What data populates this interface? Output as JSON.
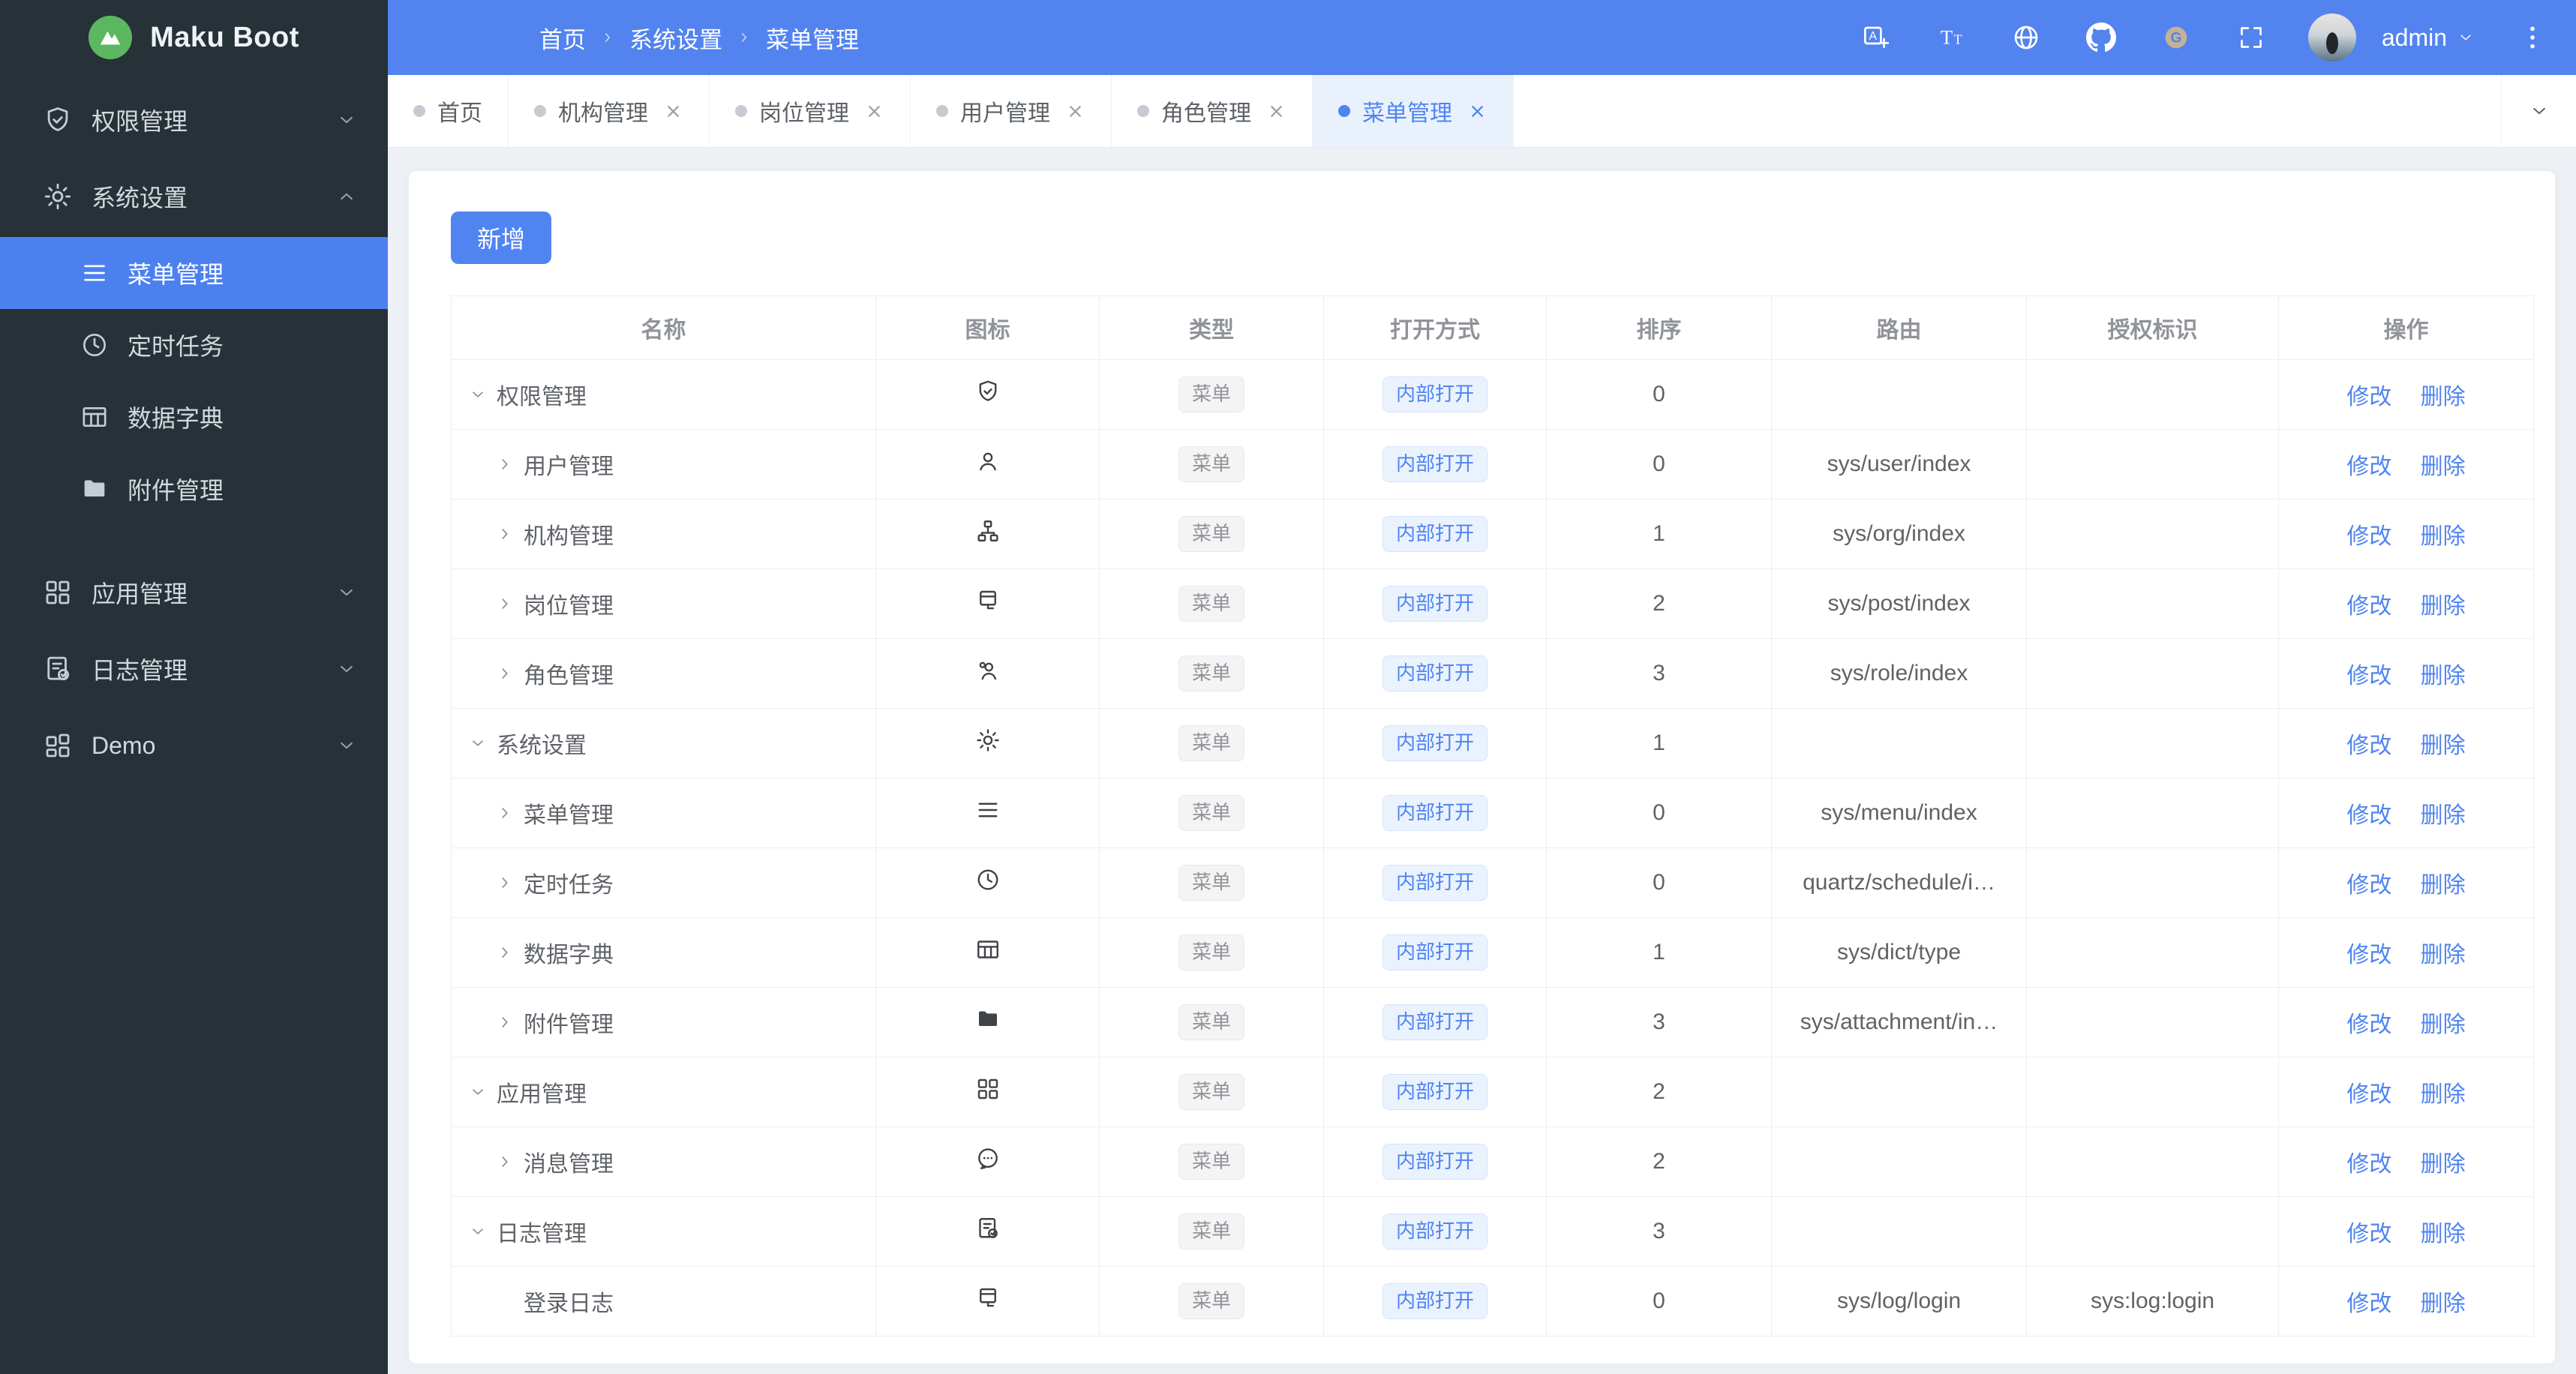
{
  "colors": {
    "accent": "#4f84f1",
    "header_bg": "#5383ef",
    "sidebar_bg": "#263238",
    "sidebar_active_bg": "#4c80ef",
    "content_bg": "#edf0f5",
    "active_tab_bg": "#e9f1fd",
    "logo_green": "#5cb860",
    "badge_gray_bg": "#f4f4f5",
    "badge_gray_text": "#909399",
    "badge_blue_bg": "#eaf2fe",
    "gitee_gold": "#c3b393"
  },
  "sidebar": {
    "logo_title": "Maku Boot",
    "items": [
      {
        "id": "permission",
        "label": "权限管理",
        "icon": "shield-check",
        "chevron": "down"
      },
      {
        "id": "system",
        "label": "系统设置",
        "icon": "gear",
        "chevron": "up",
        "children": [
          {
            "id": "menu",
            "label": "菜单管理",
            "icon": "menu",
            "active": true
          },
          {
            "id": "schedule",
            "label": "定时任务",
            "icon": "clock",
            "active": false
          },
          {
            "id": "dict",
            "label": "数据字典",
            "icon": "table",
            "active": false
          },
          {
            "id": "attachment",
            "label": "附件管理",
            "icon": "folder",
            "active": false
          }
        ]
      },
      {
        "id": "app",
        "label": "应用管理",
        "icon": "grid",
        "chevron": "down"
      },
      {
        "id": "log",
        "label": "日志管理",
        "icon": "doc-check",
        "chevron": "down"
      },
      {
        "id": "demo",
        "label": "Demo",
        "icon": "grid2",
        "chevron": "down"
      }
    ]
  },
  "header": {
    "breadcrumb": [
      "首页",
      "系统设置",
      "菜单管理"
    ],
    "actions": [
      {
        "id": "translate"
      },
      {
        "id": "font-size"
      },
      {
        "id": "globe"
      },
      {
        "id": "github"
      },
      {
        "id": "gitee"
      },
      {
        "id": "fullscreen"
      }
    ],
    "user": "admin"
  },
  "tabs": {
    "items": [
      {
        "id": "home",
        "label": "首页",
        "closable": false,
        "active": false
      },
      {
        "id": "org",
        "label": "机构管理",
        "closable": true,
        "active": false
      },
      {
        "id": "post",
        "label": "岗位管理",
        "closable": true,
        "active": false
      },
      {
        "id": "user",
        "label": "用户管理",
        "closable": true,
        "active": false
      },
      {
        "id": "role",
        "label": "角色管理",
        "closable": true,
        "active": false
      },
      {
        "id": "menu",
        "label": "菜单管理",
        "closable": true,
        "active": true
      }
    ]
  },
  "toolbar": {
    "add_label": "新增"
  },
  "table": {
    "columns": [
      "名称",
      "图标",
      "类型",
      "打开方式",
      "排序",
      "路由",
      "授权标识",
      "操作"
    ],
    "ops": {
      "edit": "修改",
      "delete": "删除"
    },
    "rows": [
      {
        "level": 0,
        "expand": "down",
        "name": "权限管理",
        "icon": "shield-check",
        "type": "菜单",
        "open": "内部打开",
        "sort": "0",
        "route": "",
        "auth": ""
      },
      {
        "level": 1,
        "expand": "right",
        "name": "用户管理",
        "icon": "user",
        "type": "菜单",
        "open": "内部打开",
        "sort": "0",
        "route": "sys/user/index",
        "auth": ""
      },
      {
        "level": 1,
        "expand": "right",
        "name": "机构管理",
        "icon": "org",
        "type": "菜单",
        "open": "内部打开",
        "sort": "1",
        "route": "sys/org/index",
        "auth": ""
      },
      {
        "level": 1,
        "expand": "right",
        "name": "岗位管理",
        "icon": "badge",
        "type": "菜单",
        "open": "内部打开",
        "sort": "2",
        "route": "sys/post/index",
        "auth": ""
      },
      {
        "level": 1,
        "expand": "right",
        "name": "角色管理",
        "icon": "user-plus",
        "type": "菜单",
        "open": "内部打开",
        "sort": "3",
        "route": "sys/role/index",
        "auth": ""
      },
      {
        "level": 0,
        "expand": "down",
        "name": "系统设置",
        "icon": "gear",
        "type": "菜单",
        "open": "内部打开",
        "sort": "1",
        "route": "",
        "auth": ""
      },
      {
        "level": 1,
        "expand": "right",
        "name": "菜单管理",
        "icon": "menu",
        "type": "菜单",
        "open": "内部打开",
        "sort": "0",
        "route": "sys/menu/index",
        "auth": ""
      },
      {
        "level": 1,
        "expand": "right",
        "name": "定时任务",
        "icon": "clock",
        "type": "菜单",
        "open": "内部打开",
        "sort": "0",
        "route": "quartz/schedule/i…",
        "auth": ""
      },
      {
        "level": 1,
        "expand": "right",
        "name": "数据字典",
        "icon": "table",
        "type": "菜单",
        "open": "内部打开",
        "sort": "1",
        "route": "sys/dict/type",
        "auth": ""
      },
      {
        "level": 1,
        "expand": "right",
        "name": "附件管理",
        "icon": "folder",
        "type": "菜单",
        "open": "内部打开",
        "sort": "3",
        "route": "sys/attachment/in…",
        "auth": ""
      },
      {
        "level": 0,
        "expand": "down",
        "name": "应用管理",
        "icon": "grid",
        "type": "菜单",
        "open": "内部打开",
        "sort": "2",
        "route": "",
        "auth": ""
      },
      {
        "level": 1,
        "expand": "right",
        "name": "消息管理",
        "icon": "chat",
        "type": "菜单",
        "open": "内部打开",
        "sort": "2",
        "route": "",
        "auth": ""
      },
      {
        "level": 0,
        "expand": "down",
        "name": "日志管理",
        "icon": "doc-check",
        "type": "菜单",
        "open": "内部打开",
        "sort": "3",
        "route": "",
        "auth": ""
      },
      {
        "level": 1,
        "expand": "none",
        "name": "登录日志",
        "icon": "badge",
        "type": "菜单",
        "open": "内部打开",
        "sort": "0",
        "route": "sys/log/login",
        "auth": "sys:log:login"
      }
    ]
  }
}
